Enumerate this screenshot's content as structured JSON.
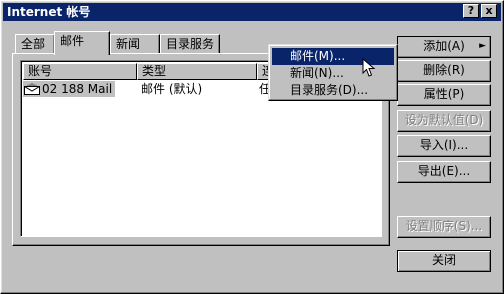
{
  "window": {
    "title": "Internet 帐号",
    "help_label": "?",
    "close_label": "x"
  },
  "tabs": [
    "全部",
    "邮件",
    "新闻",
    "目录服务"
  ],
  "list": {
    "headers": [
      "账号",
      "类型",
      "连"
    ],
    "rows": [
      {
        "account": "02 188 Mail",
        "type": "邮件 (默认)",
        "conn": "任"
      }
    ]
  },
  "buttons": {
    "add": "添加(A)",
    "add_arrow": "►",
    "remove": "删除(R)",
    "properties": "属性(P)",
    "set_default": "设为默认值(D)",
    "import": "导入(I)...",
    "export": "导出(E)...",
    "set_order": "设置顺序(S)...",
    "close": "关闭"
  },
  "menu": {
    "items": [
      "邮件(M)...",
      "新闻(N)...",
      "目录服务(D)..."
    ]
  }
}
